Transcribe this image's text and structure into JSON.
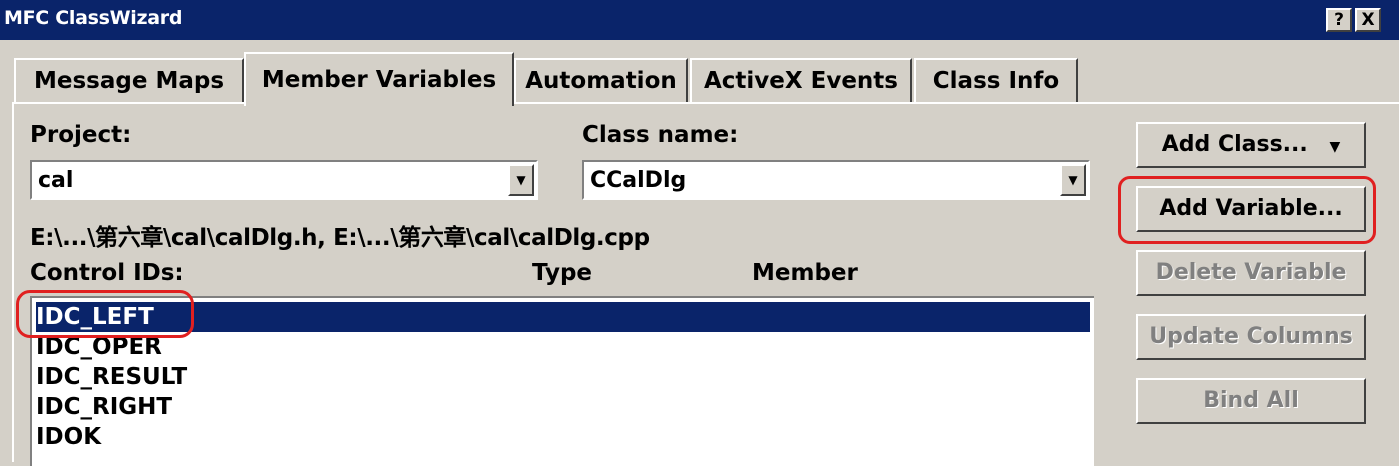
{
  "window": {
    "title": "MFC ClassWizard",
    "help_button": "?",
    "close_button": "X"
  },
  "tabs": [
    {
      "label": "Message Maps",
      "active": false
    },
    {
      "label": "Member Variables",
      "active": true
    },
    {
      "label": "Automation",
      "active": false
    },
    {
      "label": "ActiveX Events",
      "active": false
    },
    {
      "label": "Class Info",
      "active": false
    }
  ],
  "project": {
    "label": "Project:",
    "value": "cal"
  },
  "class_name": {
    "label": "Class name:",
    "value": "CCalDlg"
  },
  "file_path": "E:\\...\\第六章\\cal\\calDlg.h, E:\\...\\第六章\\cal\\calDlg.cpp",
  "list": {
    "columns": [
      "Control IDs:",
      "Type",
      "Member"
    ],
    "rows": [
      "IDC_LEFT",
      "IDC_OPER",
      "IDC_RESULT",
      "IDC_RIGHT",
      "IDOK"
    ],
    "selected_index": 0
  },
  "buttons": {
    "add_class": "Add Class...",
    "add_variable": "Add Variable...",
    "delete_variable": "Delete Variable",
    "update_columns": "Update Columns",
    "bind_all": "Bind All"
  },
  "colors": {
    "title_bar": "#0a246a",
    "face": "#d4d0c8",
    "selection": "#0a246a",
    "annotation": "#e02020"
  }
}
